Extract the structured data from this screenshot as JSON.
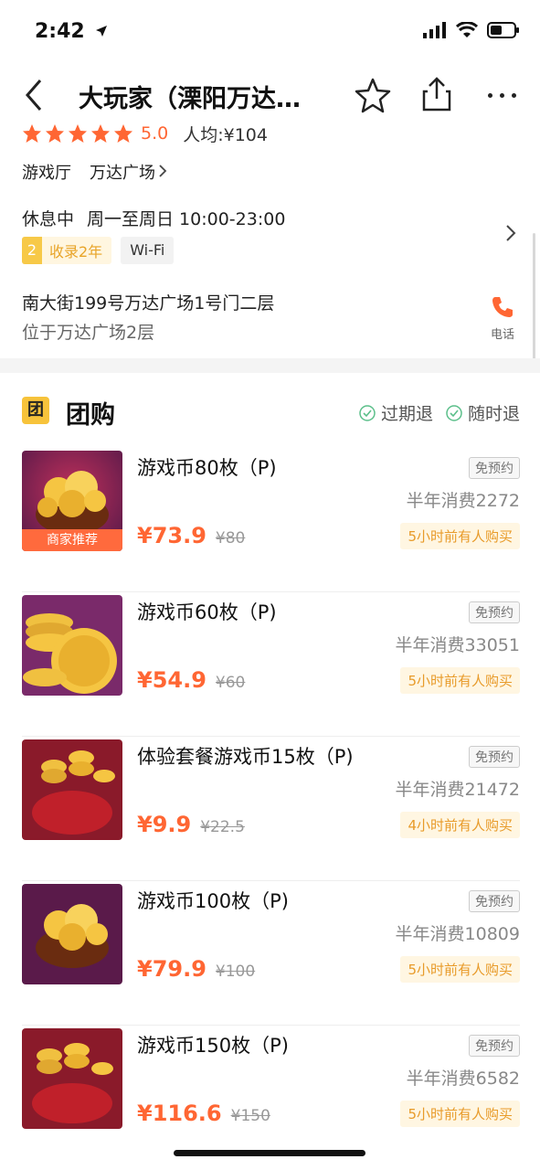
{
  "status_bar": {
    "time": "2:42"
  },
  "nav": {
    "title": "大玩家（溧阳万达…"
  },
  "shop": {
    "score": "5.0",
    "avg_price": "人均:¥104",
    "category": "游戏厅",
    "mall": "万达广场",
    "status": "休息中",
    "hours": "周一至周日 10:00-23:00",
    "tag_years_num": "2",
    "tag_years_label": "收录2年",
    "tag_wifi": "Wi-Fi",
    "address": "南大街199号万达广场1号门二层",
    "address_note": "位于万达广场2层",
    "phone_label": "电话"
  },
  "group_buy": {
    "icon_label": "团",
    "title": "团购",
    "policy_expire": "过期退",
    "policy_anytime": "随时退"
  },
  "deals": [
    {
      "name": "游戏币80枚（P)",
      "price": "¥73.9",
      "old_price": "¥80",
      "no_reservation": "免预约",
      "sales": "半年消费2272",
      "recent": "5小时前有人购买",
      "badge": "商家推荐"
    },
    {
      "name": "游戏币60枚（P)",
      "price": "¥54.9",
      "old_price": "¥60",
      "no_reservation": "免预约",
      "sales": "半年消费33051",
      "recent": "5小时前有人购买",
      "badge": ""
    },
    {
      "name": "体验套餐游戏币15枚（P)",
      "price": "¥9.9",
      "old_price": "¥22.5",
      "no_reservation": "免预约",
      "sales": "半年消费21472",
      "recent": "4小时前有人购买",
      "badge": ""
    },
    {
      "name": "游戏币100枚（P)",
      "price": "¥79.9",
      "old_price": "¥100",
      "no_reservation": "免预约",
      "sales": "半年消费10809",
      "recent": "5小时前有人购买",
      "badge": ""
    },
    {
      "name": "游戏币150枚（P)",
      "price": "¥116.6",
      "old_price": "¥150",
      "no_reservation": "免预约",
      "sales": "半年消费6582",
      "recent": "5小时前有人购买",
      "badge": ""
    }
  ],
  "colors": {
    "accent": "#ff6633",
    "star": "#ff6633",
    "tag_yellow": "#f7c948",
    "badge": "#ff6a3d"
  }
}
